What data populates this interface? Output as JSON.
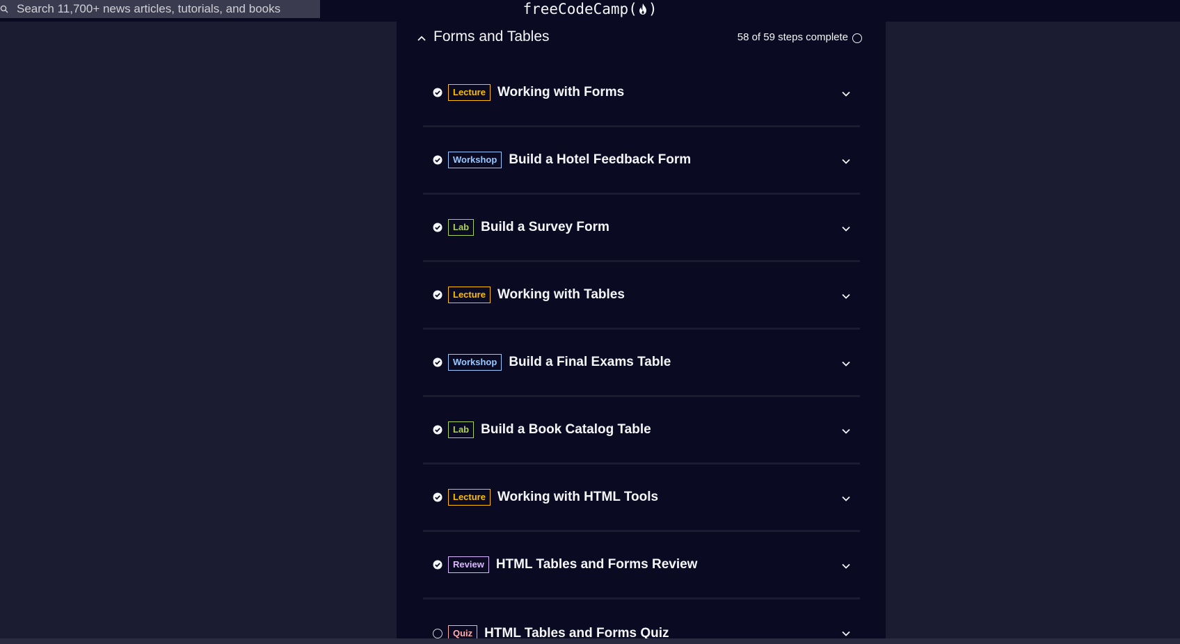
{
  "search": {
    "placeholder": "Search 11,700+ news articles, tutorials, and books"
  },
  "brand": {
    "left": "freeCodeCamp(",
    "right": ")"
  },
  "block": {
    "title": "Forms and Tables",
    "progress": "58 of 59 steps complete"
  },
  "modules": [
    {
      "type": "Lecture",
      "title": "Working with Forms",
      "completed": true
    },
    {
      "type": "Workshop",
      "title": "Build a Hotel Feedback Form",
      "completed": true
    },
    {
      "type": "Lab",
      "title": "Build a Survey Form",
      "completed": true
    },
    {
      "type": "Lecture",
      "title": "Working with Tables",
      "completed": true
    },
    {
      "type": "Workshop",
      "title": "Build a Final Exams Table",
      "completed": true
    },
    {
      "type": "Lab",
      "title": "Build a Book Catalog Table",
      "completed": true
    },
    {
      "type": "Lecture",
      "title": "Working with HTML Tools",
      "completed": true
    },
    {
      "type": "Review",
      "title": "HTML Tables and Forms Review",
      "completed": true
    },
    {
      "type": "Quiz",
      "title": "HTML Tables and Forms Quiz",
      "completed": false
    }
  ],
  "colors": {
    "background": "#1b1b32",
    "panel": "#0a0a23",
    "lecture": "#ffbf00",
    "workshop": "#99c9ff",
    "lab": "#acd157",
    "review": "#dbb8ff",
    "quiz": "#ffadad"
  }
}
